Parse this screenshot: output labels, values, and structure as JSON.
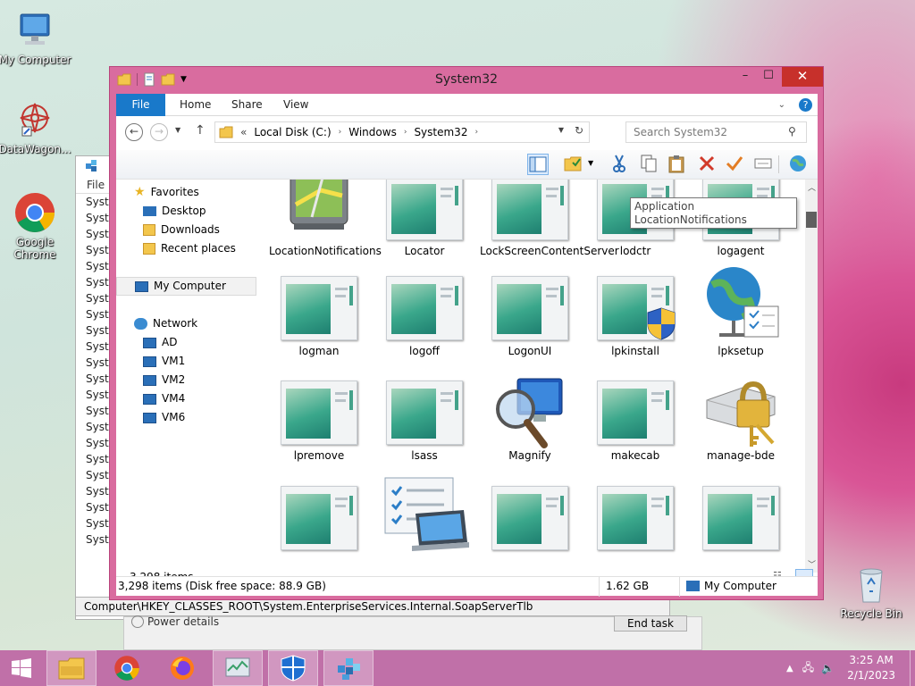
{
  "desktop": {
    "icons": [
      {
        "name": "my-computer",
        "label": "My Computer"
      },
      {
        "name": "datawagon",
        "label": "DataWagon..."
      },
      {
        "name": "google-chrome",
        "label": "Google Chrome"
      },
      {
        "name": "recycle-bin",
        "label": "Recycle Bin"
      }
    ]
  },
  "background_window": {
    "menu_file": "File",
    "rows": [
      "Syste",
      "Syste",
      "Syste",
      "Syste",
      "Syste",
      "Syste",
      "Syste",
      "Syste",
      "Syste",
      "Syste",
      "Syste",
      "Syste",
      "Syste",
      "Syste",
      "Syste",
      "Syste",
      "Syste",
      "Syste",
      "Syste",
      "Syste",
      "Syste",
      "Syste"
    ],
    "registry_path": "Computer\\HKEY_CLASSES_ROOT\\System.EnterpriseServices.Internal.SoapServerTlb",
    "power_details": "Power details",
    "end_task": "End task"
  },
  "explorer": {
    "title": "System32",
    "ribbon_tabs": {
      "file": "File",
      "home": "Home",
      "share": "Share",
      "view": "View"
    },
    "breadcrumb": {
      "overflow": "«",
      "items": [
        "Local Disk (C:)",
        "Windows",
        "System32"
      ]
    },
    "search_placeholder": "Search System32",
    "nav": {
      "favorites": "Favorites",
      "desktop": "Desktop",
      "downloads": "Downloads",
      "recent": "Recent places",
      "my_computer": "My Computer",
      "network": "Network",
      "network_items": [
        "AD",
        "VM1",
        "VM2",
        "VM4",
        "VM6"
      ]
    },
    "files_row1": [
      "LocationNotifications",
      "Locator",
      "LockScreenContentServer",
      "lodctr",
      "logagent"
    ],
    "files_row2": [
      "logman",
      "logoff",
      "LogonUI",
      "lpkinstall",
      "lpksetup"
    ],
    "files_row3": [
      "lpremove",
      "lsass",
      "Magnify",
      "makecab",
      "manage-bde"
    ],
    "tooltip": {
      "line1": "Application",
      "line2": "LocationNotifications"
    },
    "item_count": "3,298 items",
    "status_left": "3,298 items (Disk free space: 88.9 GB)",
    "status_size": "1.62 GB",
    "status_location": "My Computer"
  },
  "taskbar": {
    "time": "3:25 AM",
    "date": "2/1/2023",
    "colors": {
      "taskbar": "#c070a8",
      "window_frame": "#d96c9f",
      "close": "#c7302b",
      "file_tab": "#1979ca"
    }
  }
}
